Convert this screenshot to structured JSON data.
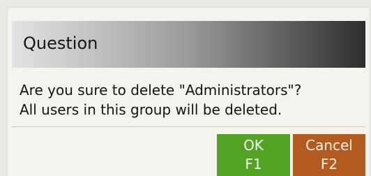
{
  "dialog": {
    "title": "Question",
    "message_line1": "Are you sure to delete \"Administrators\"?",
    "message_line2": "All users in this group will be deleted."
  },
  "buttons": {
    "ok": {
      "label": "OK",
      "shortcut": "F1",
      "color": "#52a224"
    },
    "cancel": {
      "label": "Cancel",
      "shortcut": "F2",
      "color": "#b35a1e"
    }
  }
}
